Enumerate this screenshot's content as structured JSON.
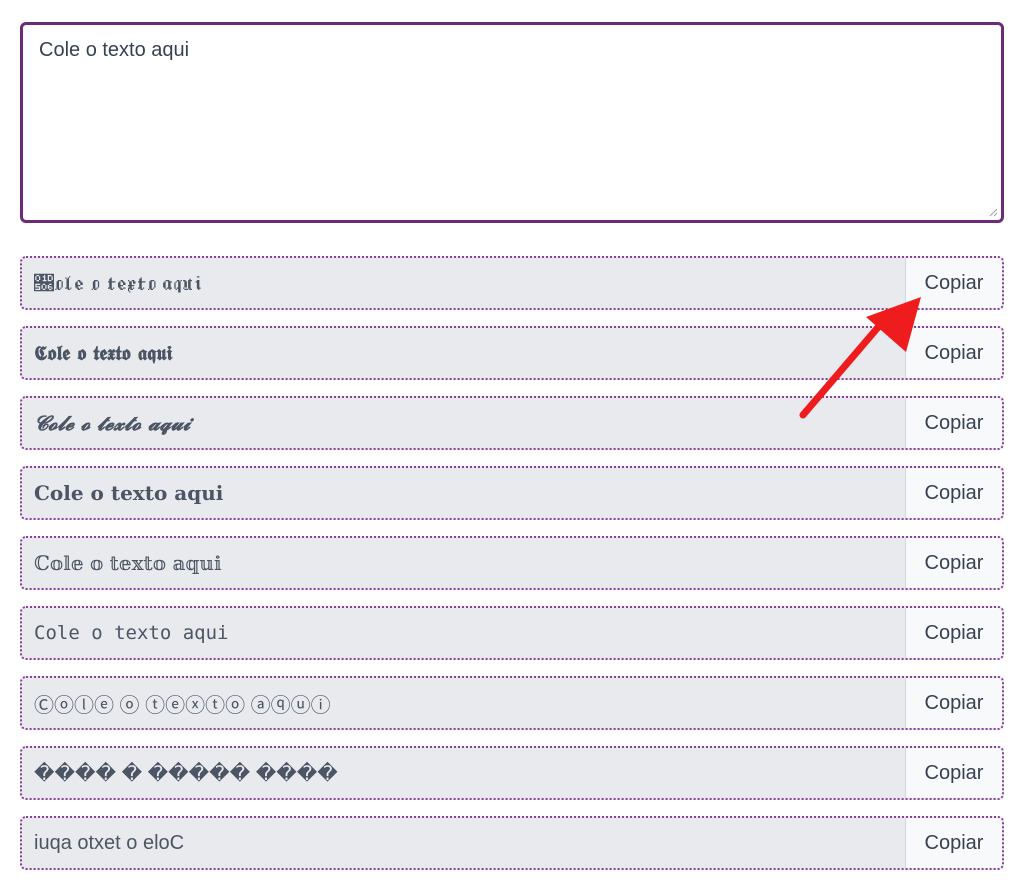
{
  "input": {
    "placeholder": "Cole o texto aqui"
  },
  "rows": [
    {
      "text": "𝔆𝔬𝔩𝔢 𝔬 𝔱𝔢𝔵𝔱𝔬 𝔞𝔮𝔲𝔦",
      "button": "Copiar"
    },
    {
      "text": "𝕮𝖔𝖑𝖊 𝖔 𝖙𝖊𝖝𝖙𝖔 𝖆𝖖𝖚𝖎",
      "button": "Copiar"
    },
    {
      "text": "𝓒𝓸𝓵𝓮 𝓸 𝓽𝓮𝔁𝓽𝓸 𝓪𝓺𝓾𝓲",
      "button": "Copiar"
    },
    {
      "text": "𝐂𝐨𝐥𝐞 𝐨 𝐭𝐞𝐱𝐭𝐨 𝐚𝐪𝐮𝐢",
      "button": "Copiar"
    },
    {
      "text": "ℂ𝕠𝕝𝕖 𝕠 𝕥𝕖𝕩𝕥𝕠 𝕒𝕢𝕦𝕚",
      "button": "Copiar"
    },
    {
      "text": "𝙲𝚘𝚕𝚎 𝚘 𝚝𝚎𝚡𝚝𝚘 𝚊𝚚𝚞𝚒",
      "button": "Copiar"
    },
    {
      "text": "Ⓒⓞⓛⓔ ⓞ ⓣⓔⓧⓣⓞ ⓐⓠⓤⓘ",
      "button": "Copiar"
    },
    {
      "text": "���� � ����� ����",
      "button": "Copiar"
    },
    {
      "text": "iuqa otxet o eloC",
      "button": "Copiar"
    }
  ],
  "colors": {
    "accent": "#6b2a7a",
    "arrow": "#ee1c1c",
    "row_bg": "#e8eaee",
    "button_bg": "#f8f9fb"
  }
}
